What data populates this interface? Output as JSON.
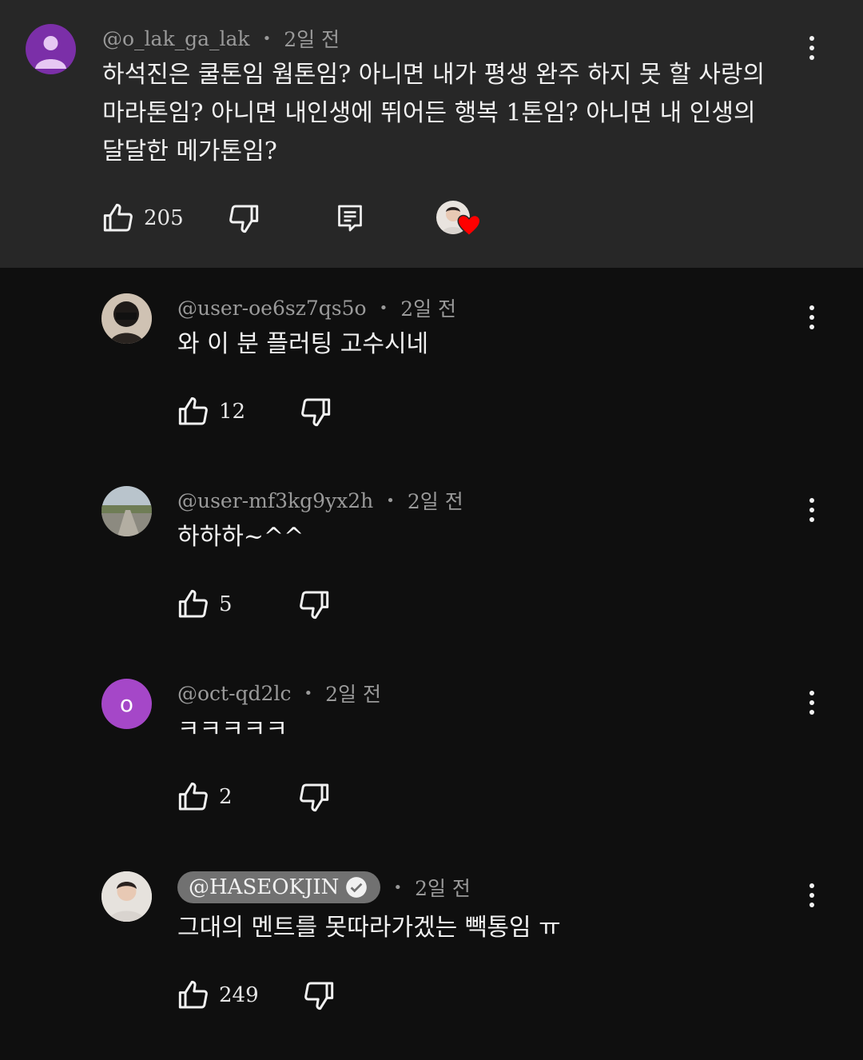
{
  "comments": [
    {
      "handle": "@o_lak_ga_lak",
      "time": "2일 전",
      "text": "하석진은 쿨톤임 웜톤임? 아니면 내가 평생 완주 하지 못 할 사랑의\n마라톤임? 아니면 내인생에 뛰어든 행복 1톤임? 아니면 내 인생의\n달달한 메가톤임?",
      "likes": "205",
      "avatar_icon": "default-user-icon"
    },
    {
      "handle": "@user-oe6sz7qs5o",
      "time": "2일 전",
      "text": "와 이 분 플러팅 고수시네",
      "likes": "12"
    },
    {
      "handle": "@user-mf3kg9yx2h",
      "time": "2일 전",
      "text": "하하하~^^",
      "likes": "5"
    },
    {
      "handle": "@oct-qd2lc",
      "time": "2일 전",
      "text": "ㅋㅋㅋㅋㅋ",
      "likes": "2",
      "avatar_letter": "o"
    },
    {
      "handle": "@HASEOKJIN",
      "time": "2일 전",
      "text": "그대의 멘트를 못따라가겠는 빽통임 ㅠ",
      "likes": "249",
      "verified": true
    }
  ],
  "colors": {
    "background": "#0f0f0f",
    "highlight_background": "#272727",
    "creator_heart": "#ff0000",
    "letter_avatar": "#a547c8"
  }
}
